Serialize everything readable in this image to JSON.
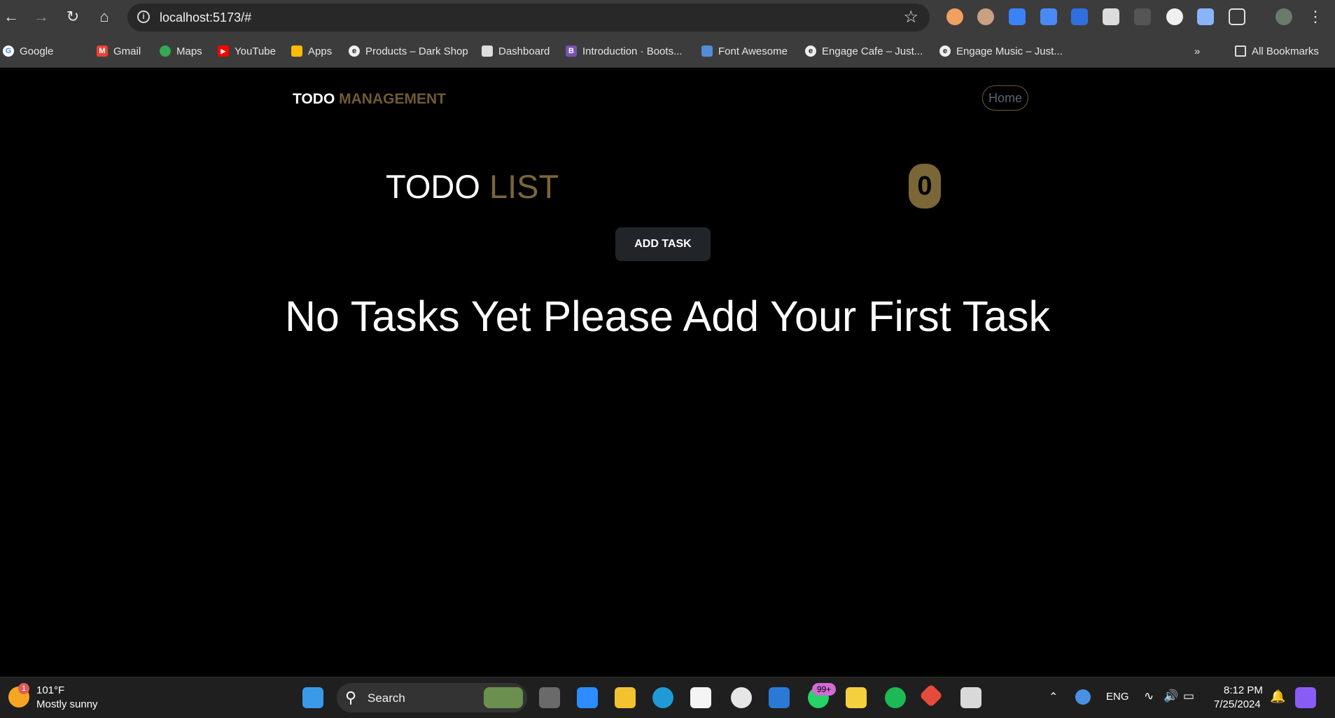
{
  "browser": {
    "url": "localhost:5173/#",
    "bookmarks": [
      {
        "label": "Google",
        "icon": "google-icon",
        "color": "#4285f4"
      },
      {
        "label": "Gmail",
        "icon": "gmail-icon",
        "color": "#ea4335"
      },
      {
        "label": "Maps",
        "icon": "maps-icon",
        "color": "#34a853"
      },
      {
        "label": "YouTube",
        "icon": "youtube-icon",
        "color": "#ff0000"
      },
      {
        "label": "Apps",
        "icon": "apps-grid-icon",
        "color": "#fbbc05"
      },
      {
        "label": "Products – Dark Shop",
        "icon": "site-icon",
        "color": "#eeeeee"
      },
      {
        "label": "Dashboard",
        "icon": "dashboard-icon",
        "color": "#dddddd"
      },
      {
        "label": "Introduction · Boots...",
        "icon": "bootstrap-icon",
        "color": "#7952b3"
      },
      {
        "label": "Font Awesome",
        "icon": "flag-icon",
        "color": "#538dd7"
      },
      {
        "label": "Engage Cafe – Just...",
        "icon": "site-icon",
        "color": "#eeeeee"
      },
      {
        "label": "Engage Music – Just...",
        "icon": "site-icon",
        "color": "#eeeeee"
      }
    ],
    "all_bookmarks": "All Bookmarks"
  },
  "app": {
    "brand_primary": "TODO",
    "brand_accent": "MANAGEMENT",
    "nav_home": "Home",
    "list_title_primary": "TODO",
    "list_title_accent": "LIST",
    "task_count": "0",
    "add_task_label": "ADD TASK",
    "empty_message": "No Tasks Yet Please Add Your First Task",
    "accent_color": "#7b6638"
  },
  "taskbar": {
    "weather_badge": "1",
    "temperature": "101°F",
    "weather_desc": "Mostly sunny",
    "search_label": "Search",
    "whatsapp_badge": "99+",
    "language": "ENG",
    "time": "8:12 PM",
    "date": "7/25/2024"
  }
}
